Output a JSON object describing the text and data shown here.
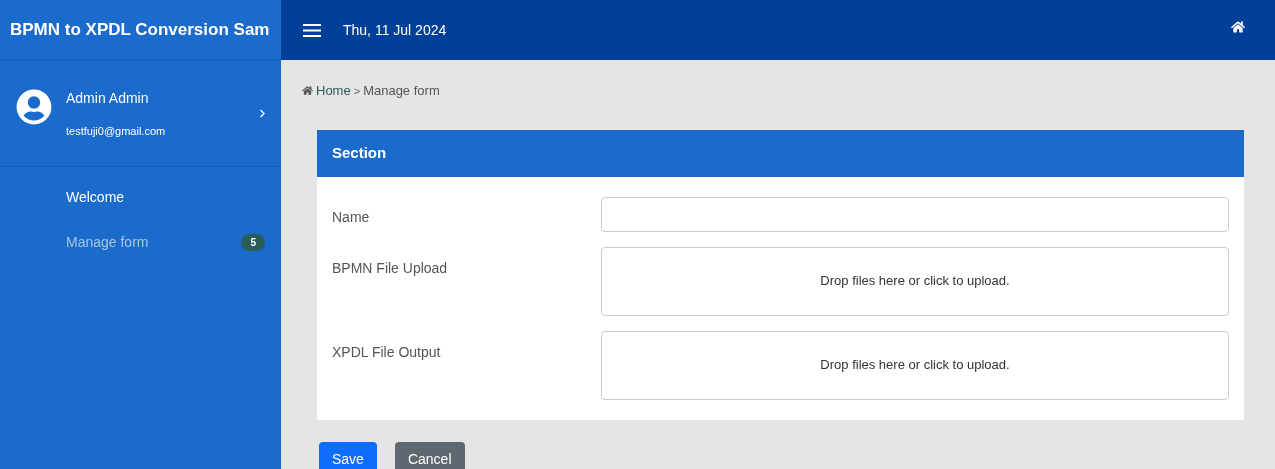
{
  "sidebar": {
    "title": "BPMN to XPDL Conversion Sam",
    "user": {
      "name": "Admin Admin",
      "email": "testfuji0@gmail.com"
    },
    "items": [
      {
        "label": "Welcome",
        "selected": false
      },
      {
        "label": "Manage form",
        "selected": true,
        "badge": "5"
      }
    ]
  },
  "topbar": {
    "date": "Thu, 11 Jul 2024"
  },
  "breadcrumb": {
    "home": "Home",
    "separator": ">",
    "current": "Manage form"
  },
  "card": {
    "title": "Section",
    "fields": [
      {
        "kind": "text",
        "label": "Name"
      },
      {
        "kind": "dropzone",
        "label": "BPMN File Upload",
        "hint": "Drop files here or click to upload."
      },
      {
        "kind": "dropzone",
        "label": "XPDL File Output",
        "hint": "Drop files here or click to upload."
      }
    ]
  },
  "buttons": [
    {
      "kind": "primary",
      "label": "Save"
    },
    {
      "kind": "secondary",
      "label": "Cancel"
    }
  ]
}
